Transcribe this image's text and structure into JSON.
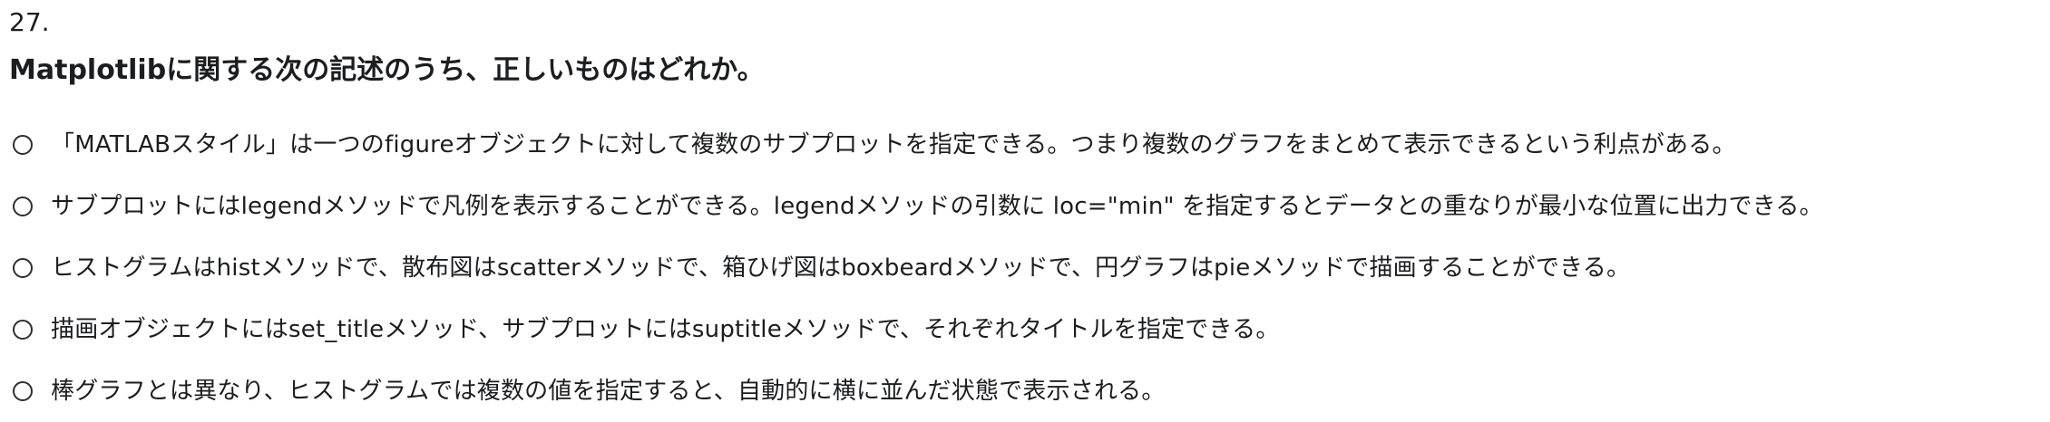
{
  "question": {
    "number": "27.",
    "text": "Matplotlibに関する次の記述のうち、正しいものはどれか。"
  },
  "options": [
    {
      "label": "「MATLABスタイル」は一つのfigureオブジェクトに対して複数のサブプロットを指定できる。つまり複数のグラフをまとめて表示できるという利点がある。"
    },
    {
      "label": "サブプロットにはlegendメソッドで凡例を表示することができる。legendメソッドの引数に loc=\"min\" を指定するとデータとの重なりが最小な位置に出力できる。"
    },
    {
      "label": "ヒストグラムはhistメソッドで、散布図はscatterメソッドで、箱ひげ図はboxbeardメソッドで、円グラフはpieメソッドで描画することができる。"
    },
    {
      "label": "描画オブジェクトにはset_titleメソッド、サブプロットにはsuptitleメソッドで、それぞれタイトルを指定できる。"
    },
    {
      "label": "棒グラフとは異なり、ヒストグラムでは複数の値を指定すると、自動的に横に並んだ状態で表示される。"
    }
  ],
  "icons": {
    "option_marker": "radio-unselected-icon"
  }
}
